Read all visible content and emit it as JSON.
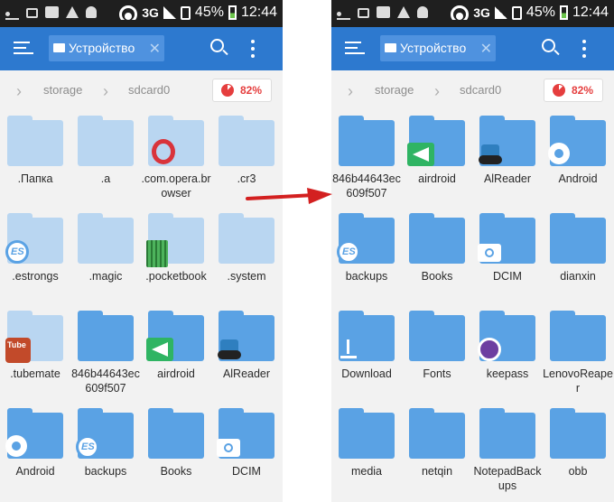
{
  "status_bar": {
    "battery": "45%",
    "time": "12:44",
    "network": "3G"
  },
  "app_bar": {
    "tab_label": "Устройство"
  },
  "breadcrumb": {
    "items": [
      "storage",
      "sdcard0"
    ],
    "storage_used": "82%"
  },
  "colors": {
    "app_bar": "#2d79cf",
    "folder": "#5aa2e4",
    "hidden_folder": "#b9d6f1",
    "accent": "#e53e3e",
    "arrow": "#d32020"
  },
  "left_panel": {
    "folders": [
      {
        "name": ".Папка",
        "style": "pale",
        "icon": ""
      },
      {
        "name": ".a",
        "style": "pale",
        "icon": ""
      },
      {
        "name": ".com.opera.browser",
        "style": "pale",
        "icon": "opera-icon"
      },
      {
        "name": ".cr3",
        "style": "pale",
        "icon": ""
      },
      {
        "name": ".estrongs",
        "style": "pale",
        "icon": "es-icon"
      },
      {
        "name": ".magic",
        "style": "pale",
        "icon": ""
      },
      {
        "name": ".pocketbook",
        "style": "pale",
        "icon": "pocketbook-icon"
      },
      {
        "name": ".system",
        "style": "pale",
        "icon": ""
      },
      {
        "name": ".tubemate",
        "style": "pale",
        "icon": "tubemate-icon"
      },
      {
        "name": "846b44643ec609f507",
        "style": "solid",
        "icon": ""
      },
      {
        "name": "airdroid",
        "style": "solid",
        "icon": "airdroid-icon"
      },
      {
        "name": "AlReader",
        "style": "solid",
        "icon": "alreader-icon"
      },
      {
        "name": "Android",
        "style": "solid",
        "icon": "gear-icon"
      },
      {
        "name": "backups",
        "style": "solid",
        "icon": "es-icon"
      },
      {
        "name": "Books",
        "style": "solid",
        "icon": ""
      },
      {
        "name": "DCIM",
        "style": "solid",
        "icon": "camera-icon"
      }
    ]
  },
  "right_panel": {
    "folders": [
      {
        "name": "846b44643ec609f507",
        "style": "solid",
        "icon": ""
      },
      {
        "name": "airdroid",
        "style": "solid",
        "icon": "airdroid-icon"
      },
      {
        "name": "AlReader",
        "style": "solid",
        "icon": "alreader-icon"
      },
      {
        "name": "Android",
        "style": "solid",
        "icon": "gear-icon"
      },
      {
        "name": "backups",
        "style": "solid",
        "icon": "es-icon"
      },
      {
        "name": "Books",
        "style": "solid",
        "icon": ""
      },
      {
        "name": "DCIM",
        "style": "solid",
        "icon": "camera-icon"
      },
      {
        "name": "dianxin",
        "style": "solid",
        "icon": ""
      },
      {
        "name": "Download",
        "style": "solid",
        "icon": "download-icon"
      },
      {
        "name": "Fonts",
        "style": "solid",
        "icon": ""
      },
      {
        "name": "keepass",
        "style": "solid",
        "icon": "keepass-icon"
      },
      {
        "name": "LenovoReaper",
        "style": "solid",
        "icon": ""
      },
      {
        "name": "media",
        "style": "solid",
        "icon": ""
      },
      {
        "name": "netqin",
        "style": "solid",
        "icon": ""
      },
      {
        "name": "NotepadBackups",
        "style": "solid",
        "icon": ""
      },
      {
        "name": "obb",
        "style": "solid",
        "icon": ""
      }
    ]
  }
}
